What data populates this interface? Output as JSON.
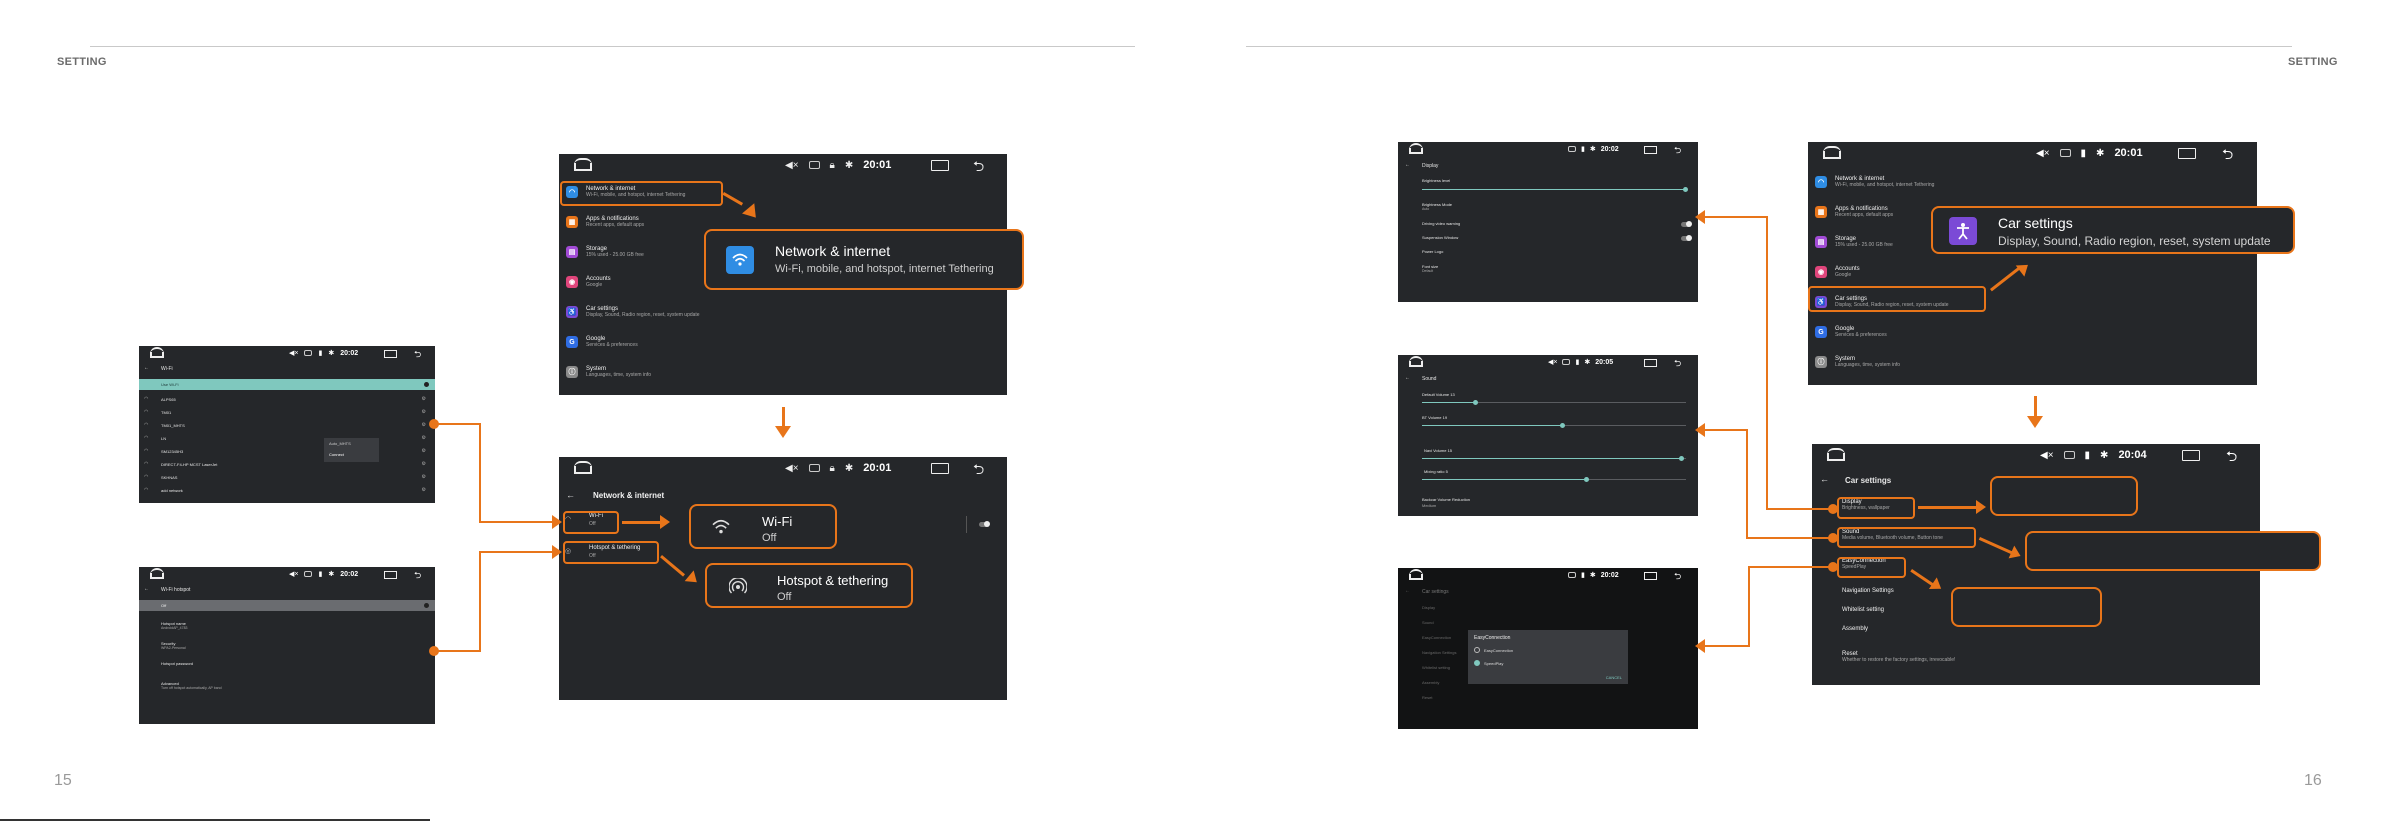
{
  "page": {
    "left_header": "SETTING",
    "right_header": "SETTING",
    "left_page_number": "15",
    "right_page_number": "16"
  },
  "main_screen": {
    "time": "20:01",
    "items": [
      {
        "title": "Network & internet",
        "subtitle": "Wi-Fi, mobile, and hotspot, internet Tethering",
        "icon": "wifi-icon",
        "color": "#2f8de4"
      },
      {
        "title": "Apps & notifications",
        "subtitle": "Recent apps, default apps",
        "icon": "apps-icon",
        "color": "#e8751a"
      },
      {
        "title": "Storage",
        "subtitle": "15% used - 25.00 GB free",
        "icon": "storage-icon",
        "color": "#a24bd6"
      },
      {
        "title": "Accounts",
        "subtitle": "Google",
        "icon": "account-icon",
        "color": "#e0457b"
      },
      {
        "title": "Car settings",
        "subtitle": "Display, Sound, Radio region, reset, system update",
        "icon": "car-icon",
        "color": "#7b4ad6"
      },
      {
        "title": "Google",
        "subtitle": "Services & preferences",
        "icon": "google-icon",
        "color": "#2f6de4"
      },
      {
        "title": "System",
        "subtitle": "Languages, time, system info",
        "icon": "system-icon",
        "color": "#8a8a8a"
      }
    ],
    "callout": {
      "title": "Network & internet",
      "subtitle": "Wi-Fi, mobile, and hotspot, internet Tethering"
    }
  },
  "network_screen": {
    "time": "20:01",
    "title": "Network & internet",
    "items": [
      {
        "title": "Wi-Fi",
        "subtitle": "Off"
      },
      {
        "title": "Hotspot & tethering",
        "subtitle": "Off"
      }
    ],
    "wifi_callout": {
      "title": "Wi-Fi",
      "subtitle": "Off"
    },
    "hotspot_callout": {
      "title": "Hotspot & tethering",
      "subtitle": "Off"
    }
  },
  "wifi_screen": {
    "time": "20:02",
    "title": "Wi-Fi",
    "toggle_row": "Use Wi-Fi",
    "networks": [
      "ALPS65",
      "TM01",
      "TM01_MHTS",
      "LN",
      "SM12345H3",
      "DIRECT-F4-HP MCST LaserJet",
      "SKHNAS",
      "add network"
    ],
    "popup_items": [
      "Auto_MHTS",
      "Connect"
    ]
  },
  "hotspot_screen": {
    "time": "20:02",
    "title": "Wi-Fi hotspot",
    "toggle_row": "Off",
    "rows": [
      {
        "title": "Hotspot name",
        "subtitle": "AndroidAP_4783"
      },
      {
        "title": "Security",
        "subtitle": "WPA2-Personal"
      },
      {
        "title": "Hotspot password",
        "subtitle": ""
      },
      {
        "title": "Advanced",
        "subtitle": "Turn off hotspot automatically, AP band"
      }
    ]
  },
  "car_menu_screen": {
    "time": "20:01",
    "items": [
      {
        "title": "Network & internet",
        "subtitle": "Wi-Fi, mobile, and hotspot, internet Tethering",
        "icon": "wifi-icon",
        "color": "#2f8de4"
      },
      {
        "title": "Apps & notifications",
        "subtitle": "Recent apps, default apps",
        "icon": "apps-icon",
        "color": "#e8751a"
      },
      {
        "title": "Storage",
        "subtitle": "15% used - 25.00 GB free",
        "icon": "storage-icon",
        "color": "#a24bd6"
      },
      {
        "title": "Accounts",
        "subtitle": "Google",
        "icon": "account-icon",
        "color": "#e0457b"
      },
      {
        "title": "Car settings",
        "subtitle": "Display, Sound, Radio region, reset, system update",
        "icon": "car-icon",
        "color": "#7b4ad6"
      },
      {
        "title": "Google",
        "subtitle": "Services & preferences",
        "icon": "google-icon",
        "color": "#2f6de4"
      },
      {
        "title": "System",
        "subtitle": "Languages, time, system info",
        "icon": "system-icon",
        "color": "#8a8a8a"
      }
    ],
    "callout": {
      "title": "Car settings",
      "subtitle": "Display, Sound, Radio region, reset, system update"
    }
  },
  "car_settings_screen": {
    "time": "20:04",
    "title": "Car settings",
    "items": [
      {
        "title": "Display",
        "subtitle": "Brightness, wallpaper"
      },
      {
        "title": "Sound",
        "subtitle": "Media volume, Bluetooth volume, Button tone"
      },
      {
        "title": "EasyConnection",
        "subtitle": "SpeedPlay"
      },
      {
        "title": "Navigation Settings",
        "subtitle": ""
      },
      {
        "title": "Whitelist setting",
        "subtitle": ""
      },
      {
        "title": "Assembly",
        "subtitle": ""
      },
      {
        "title": "Reset",
        "subtitle": "Whether to restore the factory settings, irrevocable!"
      }
    ]
  },
  "display_screen": {
    "time": "20:02",
    "title": "Display",
    "rows": [
      "Brightness level",
      "Brightness Mode",
      "Driving video warning",
      "Suspension Window",
      "Power Logo",
      "Font size"
    ],
    "row_subs": [
      "",
      "Auto",
      "",
      "",
      "",
      "Default"
    ]
  },
  "sound_screen": {
    "time": "20:05",
    "title": "Sound",
    "sliders": [
      {
        "label": "Default Volume 13",
        "level": 0.2
      },
      {
        "label": "BT Volume 19",
        "level": 0.53
      },
      {
        "label": "Navi Volume 15",
        "level": 0.98
      },
      {
        "label": "Mixing ratio 5",
        "level": 0.62
      }
    ],
    "extra_row": "Backcar Volume Reduction",
    "extra_sub": "Medium"
  },
  "easy_screen": {
    "time": "20:02",
    "title": "Car settings",
    "dialog_title": "EasyConnection",
    "options": [
      "EasyConnection",
      "SpeedPlay"
    ],
    "selected": 1,
    "cancel": "CANCEL",
    "bg_rows": [
      "Display",
      "Sound",
      "EasyConnection",
      "Navigation Settings",
      "Whitelist setting",
      "Assembly",
      "Reset"
    ]
  }
}
